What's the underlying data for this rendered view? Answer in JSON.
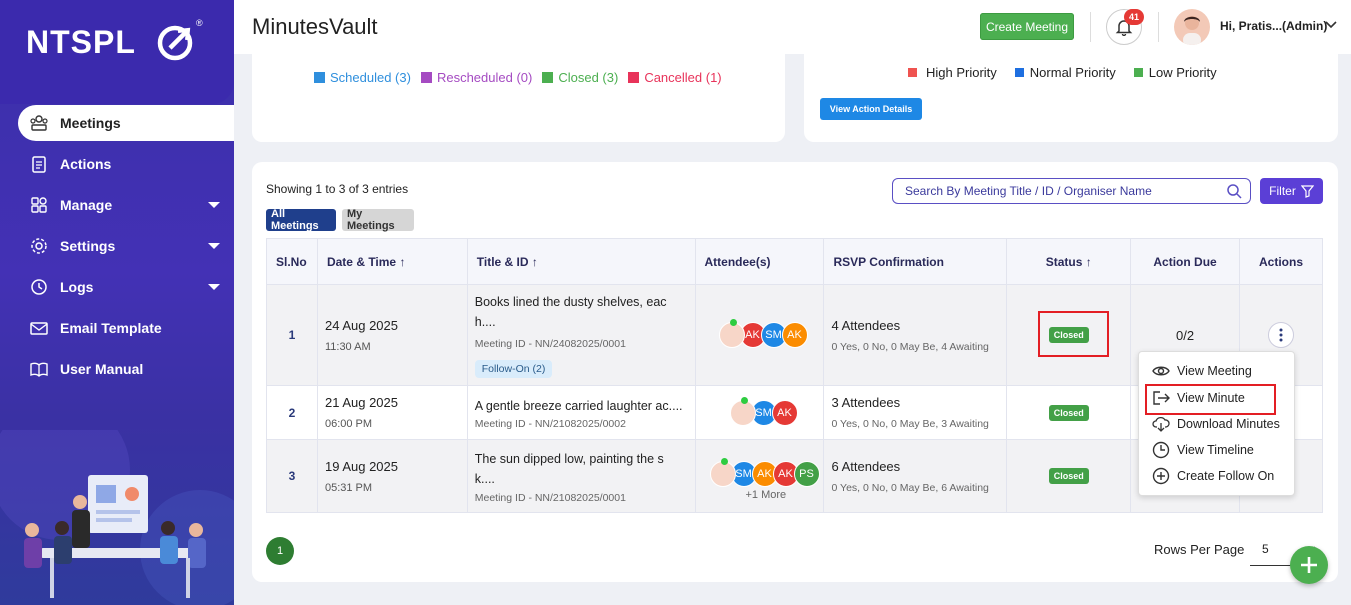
{
  "brand": {
    "logo_text": "NTSPL",
    "reg_mark": "®"
  },
  "sidebar": {
    "items": [
      {
        "label": "Meetings",
        "icon": "meetings-icon",
        "active": true
      },
      {
        "label": "Actions",
        "icon": "clipboard-icon"
      },
      {
        "label": "Manage",
        "icon": "manage-icon",
        "has_submenu": true
      },
      {
        "label": "Settings",
        "icon": "gear-icon",
        "has_submenu": true
      },
      {
        "label": "Logs",
        "icon": "history-icon",
        "has_submenu": true
      },
      {
        "label": "Email Template",
        "icon": "email-icon"
      },
      {
        "label": "User Manual",
        "icon": "book-icon"
      }
    ]
  },
  "header": {
    "title": "MinutesVault",
    "create_label": "Create Meeting",
    "notification_count": "41",
    "user_label": "Hi, Pratis...(Admin)"
  },
  "meeting_legend": [
    {
      "label": "Scheduled (3)",
      "color": "#2f8fdd"
    },
    {
      "label": "Rescheduled (0)",
      "color": "#a54bc2"
    },
    {
      "label": "Closed (3)",
      "color": "#4caf50"
    },
    {
      "label": "Cancelled (1)",
      "color": "#e8335a"
    }
  ],
  "action_legend": [
    {
      "label": "High Priority",
      "color": "#ef5350"
    },
    {
      "label": "Normal Priority",
      "color": "#1e6fe0"
    },
    {
      "label": "Low Priority",
      "color": "#4caf50"
    }
  ],
  "view_action_label": "View Action Details",
  "list": {
    "showing": "Showing 1 to 3 of 3 entries",
    "tab_all": "All Meetings",
    "tab_my": "My Meetings",
    "search_placeholder": "Search By Meeting Title / ID / Organiser Name",
    "filter_label": "Filter",
    "headers": {
      "sl": "Sl.No",
      "date": "Date & Time",
      "title": "Title & ID",
      "attendees": "Attendee(s)",
      "rsvp": "RSVP Confirmation",
      "status": "Status",
      "due": "Action Due",
      "actions": "Actions"
    },
    "rows": [
      {
        "sl": "1",
        "date": "24 Aug 2025",
        "time": "11:30 AM",
        "title_l1": "Books lined the dusty shelves, eac",
        "title_l2": "h....",
        "mid": "Meeting ID - NN/24082025/0001",
        "follow": "Follow-On (2)",
        "rsvp": "4 Attendees",
        "rsvp_sub": "0 Yes, 0 No, 0 May Be, 4 Awaiting",
        "status": "Closed",
        "due": "0/2"
      },
      {
        "sl": "2",
        "date": "21 Aug 2025",
        "time": "06:00 PM",
        "title_l1": "A gentle breeze carried laughter ac....",
        "mid": "Meeting ID - NN/21082025/0002",
        "rsvp": "3 Attendees",
        "rsvp_sub": "0 Yes, 0 No, 0 May Be, 3 Awaiting",
        "status": "Closed"
      },
      {
        "sl": "3",
        "date": "19 Aug 2025",
        "time": "05:31 PM",
        "title_l1": "The sun dipped low, painting the s",
        "title_l2": "k....",
        "mid": "Meeting ID - NN/21082025/0001",
        "rsvp": "6 Attendees",
        "rsvp_sub": "0 Yes, 0 No, 0 May Be, 6 Awaiting",
        "status": "Closed",
        "more": "+1 More"
      }
    ],
    "avatars": {
      "ak": "AK",
      "sm": "SM",
      "ps": "PS"
    }
  },
  "context_menu": [
    {
      "label": "View Meeting",
      "icon": "eye-icon"
    },
    {
      "label": "View Minute",
      "icon": "export-icon"
    },
    {
      "label": "Download Minutes",
      "icon": "cloud-download-icon"
    },
    {
      "label": "View Timeline",
      "icon": "clock-icon"
    },
    {
      "label": "Create Follow On",
      "icon": "plus-circle-icon"
    }
  ],
  "pagination": {
    "page": "1",
    "rows_label": "Rows Per Page",
    "rows_value": "5"
  }
}
